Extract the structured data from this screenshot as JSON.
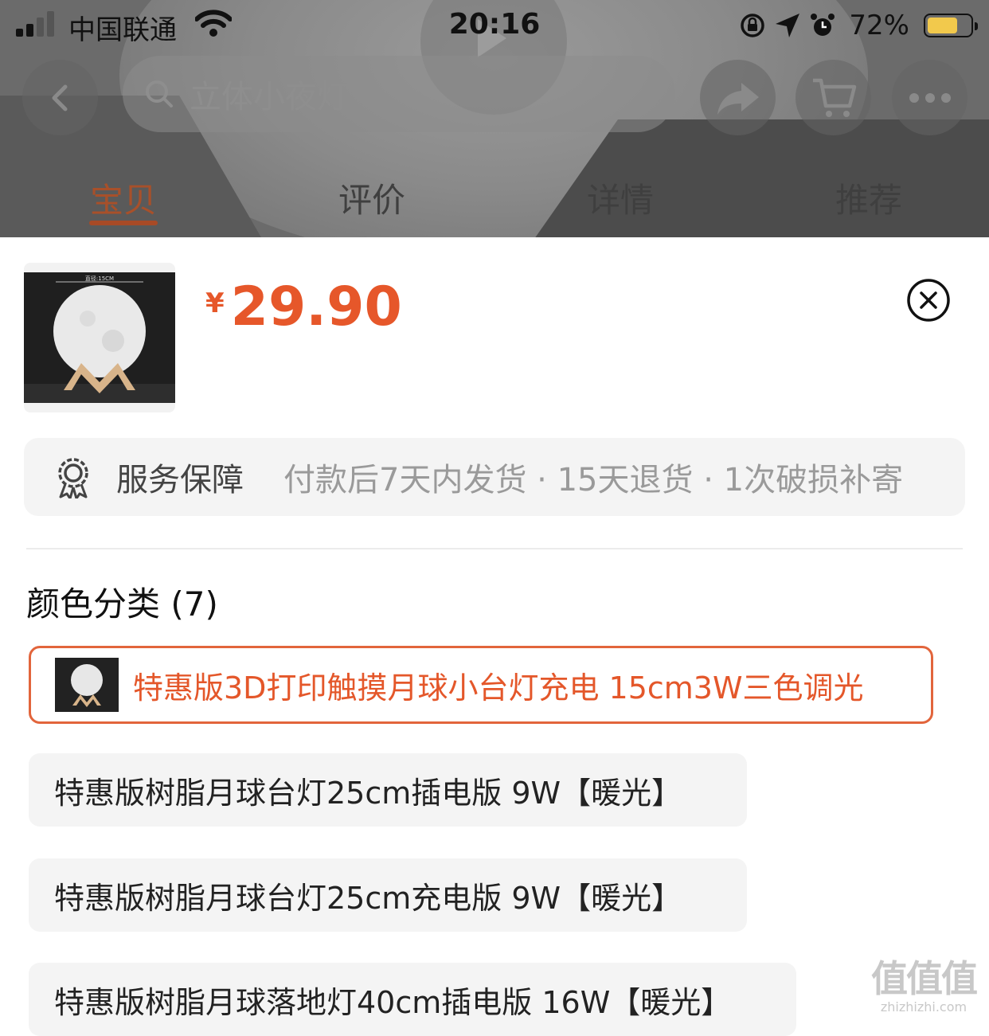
{
  "status_bar": {
    "carrier": "中国联通",
    "time": "20:16",
    "battery_percent": "72%",
    "battery_level": 0.72,
    "battery_color": "#f2c94c"
  },
  "header": {
    "back_icon": "chevron-left-icon",
    "search_placeholder": "立体小夜灯",
    "share_icon": "share-icon",
    "cart_icon": "cart-icon",
    "more_icon": "more-icon",
    "tabs": [
      {
        "label": "宝贝",
        "active": true
      },
      {
        "label": "评价",
        "active": false
      },
      {
        "label": "详情",
        "active": false
      },
      {
        "label": "推荐",
        "active": false
      }
    ]
  },
  "sku_sheet": {
    "currency": "¥",
    "price": "29.90",
    "accent_color": "#e6572a",
    "close_icon": "close-circle-icon",
    "thumbnail_caption": "直径:15CM",
    "service": {
      "icon": "badge-icon",
      "label": "服务保障",
      "detail": "付款后7天内发货 · 15天退货 · 1次破损补寄"
    },
    "section_title": "颜色分类 (7)",
    "options": [
      {
        "label": "特惠版3D打印触摸月球小台灯充电 15cm3W三色调光",
        "selected": true,
        "has_image": true
      },
      {
        "label": "特惠版树脂月球台灯25cm插电版 9W【暖光】",
        "selected": false
      },
      {
        "label": "特惠版树脂月球台灯25cm充电版 9W【暖光】",
        "selected": false
      },
      {
        "label": "特惠版树脂月球落地灯40cm插电版 16W【暖光】",
        "selected": false
      }
    ]
  },
  "watermark": {
    "main": "值值值",
    "sub": "zhizhizhi.com"
  }
}
